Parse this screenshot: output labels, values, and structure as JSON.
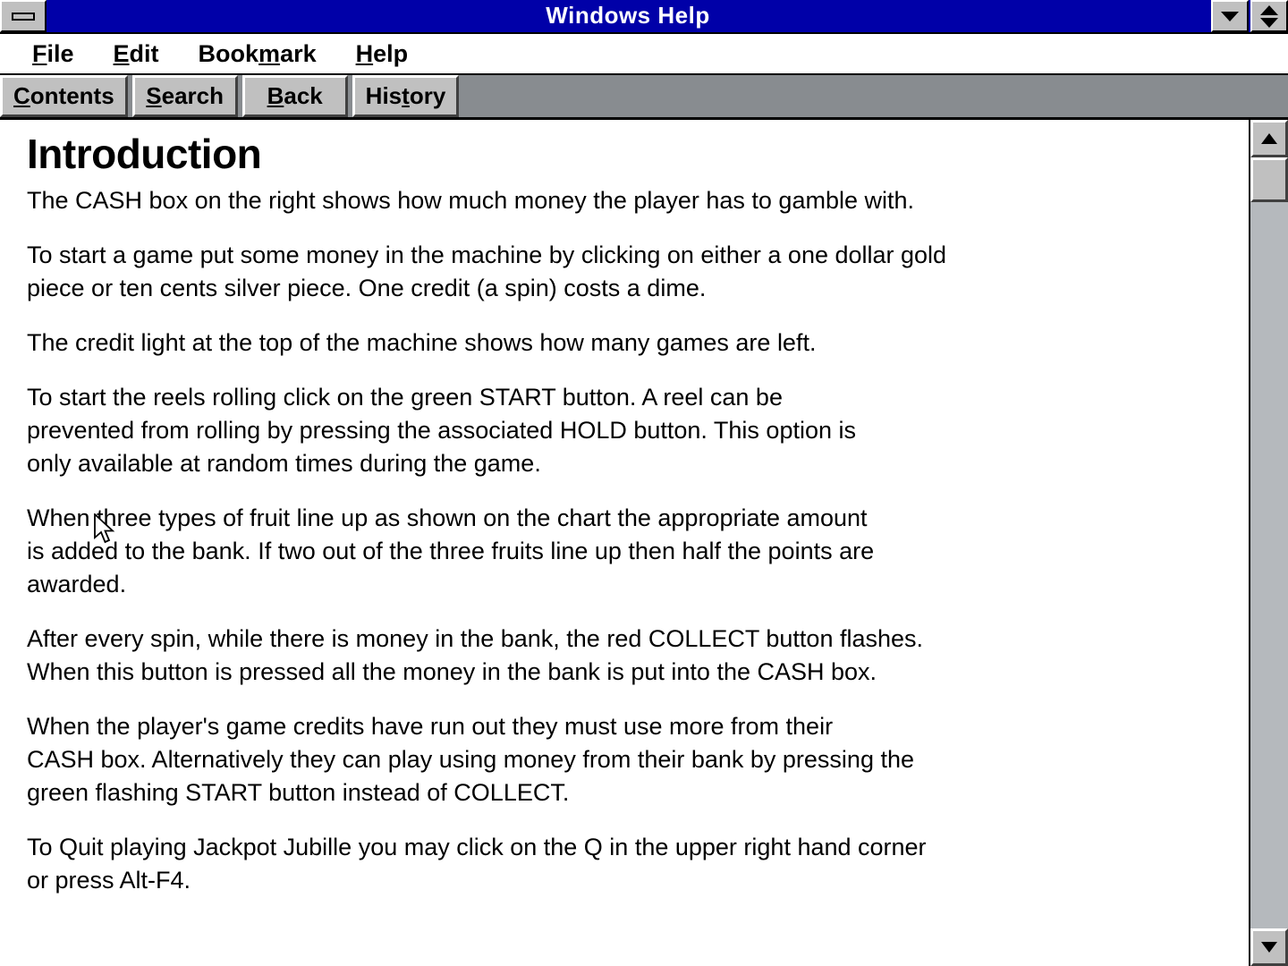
{
  "window": {
    "title": "Windows Help",
    "sysmenu_icon": "minimize-bar-icon",
    "minimize_icon": "arrow-down-icon",
    "restore_icon": "restore-updown-icon"
  },
  "menubar": {
    "items": [
      {
        "pre": "",
        "mnemonic": "F",
        "post": "ile",
        "name": "menu-file"
      },
      {
        "pre": "",
        "mnemonic": "E",
        "post": "dit",
        "name": "menu-edit"
      },
      {
        "pre": "Book",
        "mnemonic": "m",
        "post": "ark",
        "name": "menu-bookmark"
      },
      {
        "pre": "",
        "mnemonic": "H",
        "post": "elp",
        "name": "menu-help"
      }
    ]
  },
  "toolbar": {
    "buttons": [
      {
        "pre": "",
        "mnemonic": "C",
        "post": "ontents",
        "name": "toolbar-contents-button"
      },
      {
        "pre": "",
        "mnemonic": "S",
        "post": "earch",
        "name": "toolbar-search-button"
      },
      {
        "pre": "",
        "mnemonic": "B",
        "post": "ack",
        "name": "toolbar-back-button"
      },
      {
        "pre": "His",
        "mnemonic": "t",
        "post": "ory",
        "name": "toolbar-history-button"
      }
    ]
  },
  "content": {
    "heading": "Introduction",
    "paragraphs": [
      "The CASH box on the right shows how much money the player has to gamble with.",
      "To start a game put some money in the machine by clicking on either a one dollar gold\npiece or ten cents silver piece.  One credit (a spin) costs a dime.",
      "The credit light at the top of the machine shows how many games are left.",
      "To start the reels rolling click on the green START button.  A reel can be\nprevented from rolling by pressing the associated HOLD button.  This option is\nonly available at random times during the game.",
      "When three types of fruit line up as shown on the chart the appropriate amount\nis added to the bank.  If two out of the three fruits line up then half the points are\nawarded.",
      "After every spin, while there is money in the bank, the red COLLECT button flashes.\nWhen this button is pressed all the money in the bank is put into the CASH box.",
      "When the player's game credits have run out they must use more from their\nCASH box.  Alternatively they can play using money from their bank by pressing the\ngreen flashing START button instead of COLLECT.",
      "To Quit playing Jackpot Jubille you may click on the Q in the upper right hand corner\nor press Alt-F4."
    ]
  },
  "scrollbar": {
    "up_icon": "scroll-up-arrow-icon",
    "down_icon": "scroll-down-arrow-icon",
    "thumb_position_percent": 0
  },
  "colors": {
    "titlebar": "#0000a8",
    "titlebar_text": "#ffffff",
    "button_face": "#c0c0c0",
    "toolbar_bg": "#888c90",
    "content_bg": "#ffffff",
    "text": "#000000"
  }
}
